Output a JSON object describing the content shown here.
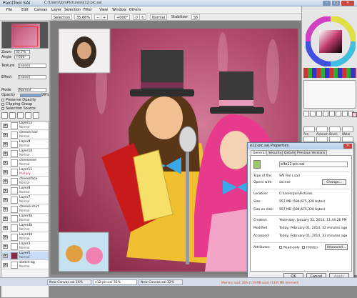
{
  "app": {
    "title": "PaintTool SAI",
    "doc_path": "C:\\Users\\Jon\\Pictures\\e12-pic.sai"
  },
  "menu": [
    "File",
    "Edit",
    "Canvas",
    "Layer",
    "Selection",
    "Filter",
    "View",
    "Window",
    "Others"
  ],
  "toolbar": {
    "selection": "Selection",
    "zoom": "35.66%",
    "angle": "+000°",
    "blend": "Normal",
    "stabilizer_label": "Stabilizer",
    "stabilizer": "S5"
  },
  "navigator": {
    "zoom_label": "Zoom",
    "zoom": "35.7%",
    "angle_label": "Angle",
    "angle": "+000°"
  },
  "texture": {
    "label": "Texture",
    "value": "[none]"
  },
  "effect": {
    "label": "Effect",
    "value": "[none]"
  },
  "layer_props": {
    "mode_label": "Mode",
    "mode": "Normal",
    "opacity_label": "Opacity",
    "opacity": "99%",
    "preserve_opacity": "Preserve Opacity",
    "clipping_group": "Clipping Group",
    "selection_source": "Selection Source"
  },
  "layers": [
    {
      "name": "Layer12",
      "mode": "Normal",
      "opacity": "100%"
    },
    {
      "name": "cheese hair",
      "mode": "Normal",
      "opacity": "100%"
    },
    {
      "name": "Layer9",
      "mode": "Normal",
      "opacity": "100%"
    },
    {
      "name": "Layer10",
      "mode": "Normal",
      "opacity": "100%"
    },
    {
      "name": "cheesesee",
      "mode": "Normal",
      "opacity": "100%"
    },
    {
      "name": "Layer11",
      "mode": "Multiply",
      "opacity": "100%"
    },
    {
      "name": "cheeseface",
      "mode": "Normal",
      "opacity": "100%"
    },
    {
      "name": "Layer8",
      "mode": "Normal",
      "opacity": "100%"
    },
    {
      "name": "Layer7",
      "mode": "Normal",
      "opacity": "100%"
    },
    {
      "name": "cheese shirt",
      "mode": "Normal",
      "opacity": "100%"
    },
    {
      "name": "Layer4b",
      "mode": "Normal",
      "opacity": "100%"
    },
    {
      "name": "Layer4b",
      "mode": "Normal",
      "opacity": "100%"
    },
    {
      "name": "Layer4d",
      "mode": "Normal",
      "opacity": "100%"
    },
    {
      "name": "Layer3",
      "mode": "Normal",
      "opacity": "100%"
    },
    {
      "name": "Layer5",
      "mode": "Normal",
      "opacity": "100%"
    },
    {
      "name": "sketch bg",
      "mode": "Normal",
      "opacity": "100%"
    }
  ],
  "tools": [
    "Pen",
    "Airbrush",
    "Brush",
    "Water",
    "Marker",
    "Eraser",
    "Select",
    "Deselect"
  ],
  "taskbar": [
    {
      "label": "New Canvas.sai",
      "pct": "16%"
    },
    {
      "label": "e12-pic.sai",
      "pct": "35%"
    },
    {
      "label": "New Canvas.sai",
      "pct": "32%"
    }
  ],
  "status": "Memory load: 28% (119 MB used / 1335 MB reserved)",
  "dialog": {
    "title": "e12-pic.sai Properties",
    "tabs": [
      "General",
      "Security",
      "Details",
      "Previous Versions"
    ],
    "filename": "e4e12-pic.sai",
    "type_label": "Type of file:",
    "type": "SAI File (.sai)",
    "opens_label": "Opens with:",
    "opens": "sai.exe",
    "change": "Change...",
    "location_label": "Location:",
    "location": "C:\\Users\\Jon\\Pictures",
    "size_label": "Size:",
    "size": "557 MB (584,675,328 bytes)",
    "disk_label": "Size on disk:",
    "disk": "557 MB (584,675,328 bytes)",
    "created_label": "Created:",
    "created": "Yesterday, January 31, 2014, 11:44:26 PM",
    "modified_label": "Modified:",
    "modified": "Today, February 01, 2014, 32 minutes ago",
    "accessed_label": "Accessed:",
    "accessed": "Today, February 01, 2014, 32 minutes ago",
    "attr_label": "Attributes:",
    "readonly": "Read-only",
    "hidden": "Hidden",
    "advanced": "Advanced...",
    "ok": "OK",
    "cancel": "Cancel",
    "apply": "Apply"
  },
  "colors": {
    "accent": "#b24c6e",
    "title_bar": "#c4d3e6",
    "selected_layer": "#c8dcf6"
  }
}
